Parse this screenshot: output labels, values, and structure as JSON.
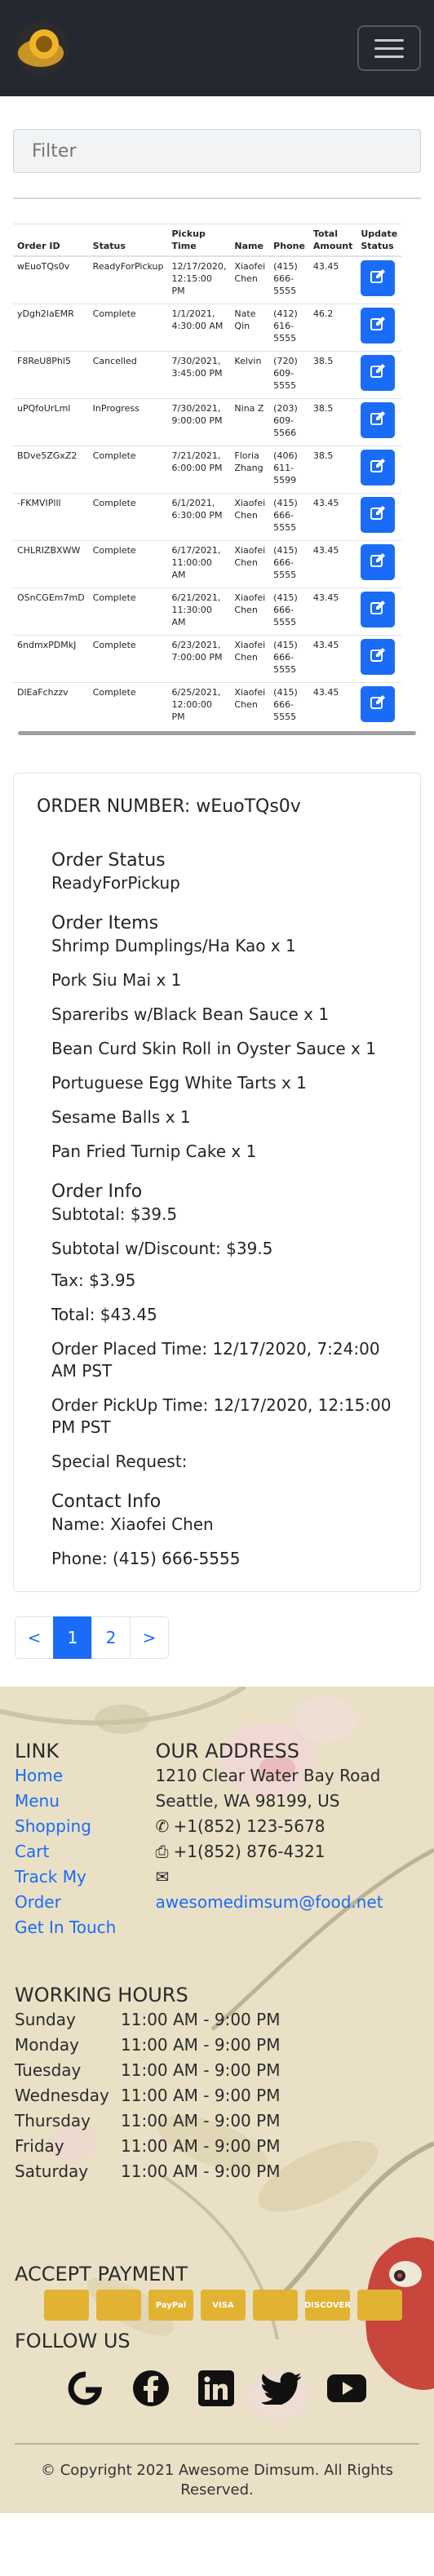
{
  "brand": {
    "logo_icon": "awesome-dimsum-logo"
  },
  "filter": {
    "placeholder": "Filter"
  },
  "table": {
    "headers": [
      "Order ID",
      "Status",
      "Pickup Time",
      "Name",
      "Phone",
      "Total Amount",
      "Update Status"
    ],
    "rows": [
      {
        "id": "wEuoTQs0v",
        "status": "ReadyForPickup",
        "pickup": "12/17/2020, 12:15:00 PM",
        "name": "Xiaofei Chen",
        "phone": "(415) 666-5555",
        "total": "43.45"
      },
      {
        "id": "yDgh2laEMR",
        "status": "Complete",
        "pickup": "1/1/2021, 4:30:00 AM",
        "name": "Nate Qin",
        "phone": "(412) 616-5555",
        "total": "46.2"
      },
      {
        "id": "F8ReU8Phl5",
        "status": "Cancelled",
        "pickup": "7/30/2021, 3:45:00 PM",
        "name": "Kelvin",
        "phone": "(720) 609-5555",
        "total": "38.5"
      },
      {
        "id": "uPQfoUrLml",
        "status": "InProgress",
        "pickup": "7/30/2021, 9:00:00 PM",
        "name": "Nina Z",
        "phone": "(203) 609-5566",
        "total": "38.5"
      },
      {
        "id": "BDve5ZGxZ2",
        "status": "Complete",
        "pickup": "7/21/2021, 6:00:00 PM",
        "name": "Floria Zhang",
        "phone": "(406) 611-5599",
        "total": "38.5"
      },
      {
        "id": "-FKMVIPlll",
        "status": "Complete",
        "pickup": "6/1/2021, 6:30:00 PM",
        "name": "Xiaofei Chen",
        "phone": "(415) 666-5555",
        "total": "43.45"
      },
      {
        "id": "CHLRIZBXWW",
        "status": "Complete",
        "pickup": "6/17/2021, 11:00:00 AM",
        "name": "Xiaofei Chen",
        "phone": "(415) 666-5555",
        "total": "43.45"
      },
      {
        "id": "OSnCGEm7mD",
        "status": "Complete",
        "pickup": "6/21/2021, 11:30:00 AM",
        "name": "Xiaofei Chen",
        "phone": "(415) 666-5555",
        "total": "43.45"
      },
      {
        "id": "6ndmxPDMkJ",
        "status": "Complete",
        "pickup": "6/23/2021, 7:00:00 PM",
        "name": "Xiaofei Chen",
        "phone": "(415) 666-5555",
        "total": "43.45"
      },
      {
        "id": "DlEaFchzzv",
        "status": "Complete",
        "pickup": "6/25/2021, 12:00:00 PM",
        "name": "Xiaofei Chen",
        "phone": "(415) 666-5555",
        "total": "43.45"
      }
    ],
    "update_icon": "edit-icon"
  },
  "order": {
    "number_label": "ORDER NUMBER: wEuoTQs0v",
    "status_title": "Order Status",
    "status_value": "ReadyForPickup",
    "items_title": "Order Items",
    "items": [
      "Shrimp Dumplings/Ha Kao x 1",
      "Pork Siu Mai x 1",
      "Spareribs w/Black Bean Sauce x 1",
      "Bean Curd Skin Roll in Oyster Sauce x 1",
      "Portuguese Egg White Tarts x 1",
      "Sesame Balls x 1",
      "Pan Fried Turnip Cake x 1"
    ],
    "info_title": "Order Info",
    "subtotal": "Subtotal: $39.5",
    "subtotal_discount": "Subtotal w/Discount: $39.5",
    "tax": "Tax: $3.95",
    "total": "Total: $43.45",
    "placed": "Order Placed Time: 12/17/2020, 7:24:00 AM PST",
    "pickup": "Order PickUp Time: 12/17/2020, 12:15:00 PM PST",
    "special": "Special Request:",
    "contact_title": "Contact Info",
    "name": "Name: Xiaofei Chen",
    "phone": "Phone: (415) 666-5555"
  },
  "pagination": {
    "prev": "<",
    "pages": [
      "1",
      "2"
    ],
    "active": "1",
    "next": ">"
  },
  "footer": {
    "link_title": "LINK",
    "links": [
      "Home",
      "Menu",
      "Shopping Cart",
      "Track My Order",
      "Get In Touch"
    ],
    "address_title": "OUR ADDRESS",
    "address_line1": "1210 Clear Water Bay Road",
    "address_line2": "Seattle, WA 98199, US",
    "phone1": "+1(852) 123-5678",
    "phone2": "+1(852) 876-4321",
    "email": "awesomedimsum@food.net",
    "hours_title": "WORKING HOURS",
    "hours": [
      {
        "day": "Sunday",
        "time": "11:00 AM - 9:00 PM"
      },
      {
        "day": "Monday",
        "time": "11:00 AM - 9:00 PM"
      },
      {
        "day": "Tuesday",
        "time": "11:00 AM - 9:00 PM"
      },
      {
        "day": "Wednesday",
        "time": "11:00 AM - 9:00 PM"
      },
      {
        "day": "Thursday",
        "time": "11:00 AM - 9:00 PM"
      },
      {
        "day": "Friday",
        "time": "11:00 AM - 9:00 PM"
      },
      {
        "day": "Saturday",
        "time": "11:00 AM - 9:00 PM"
      }
    ],
    "accept_title": "ACCEPT PAYMENT",
    "payments": [
      "alipay-icon",
      "wechat-pay-icon",
      "paypal-icon",
      "visa-icon",
      "amex-icon",
      "discover-icon",
      "mastercard-icon"
    ],
    "payment_labels": [
      "",
      "",
      "PayPal",
      "VISA",
      "",
      "DISCOVER",
      ""
    ],
    "follow_title": "FOLLOW US",
    "social": [
      "google-icon",
      "facebook-icon",
      "linkedin-icon",
      "twitter-icon",
      "youtube-icon"
    ],
    "copyright": "© Copyright 2021 Awesome Dimsum. All Rights Reserved."
  },
  "colors": {
    "primary": "#1a6cf6",
    "navbar": "#252830",
    "footer_bg": "#e8dfc4"
  }
}
